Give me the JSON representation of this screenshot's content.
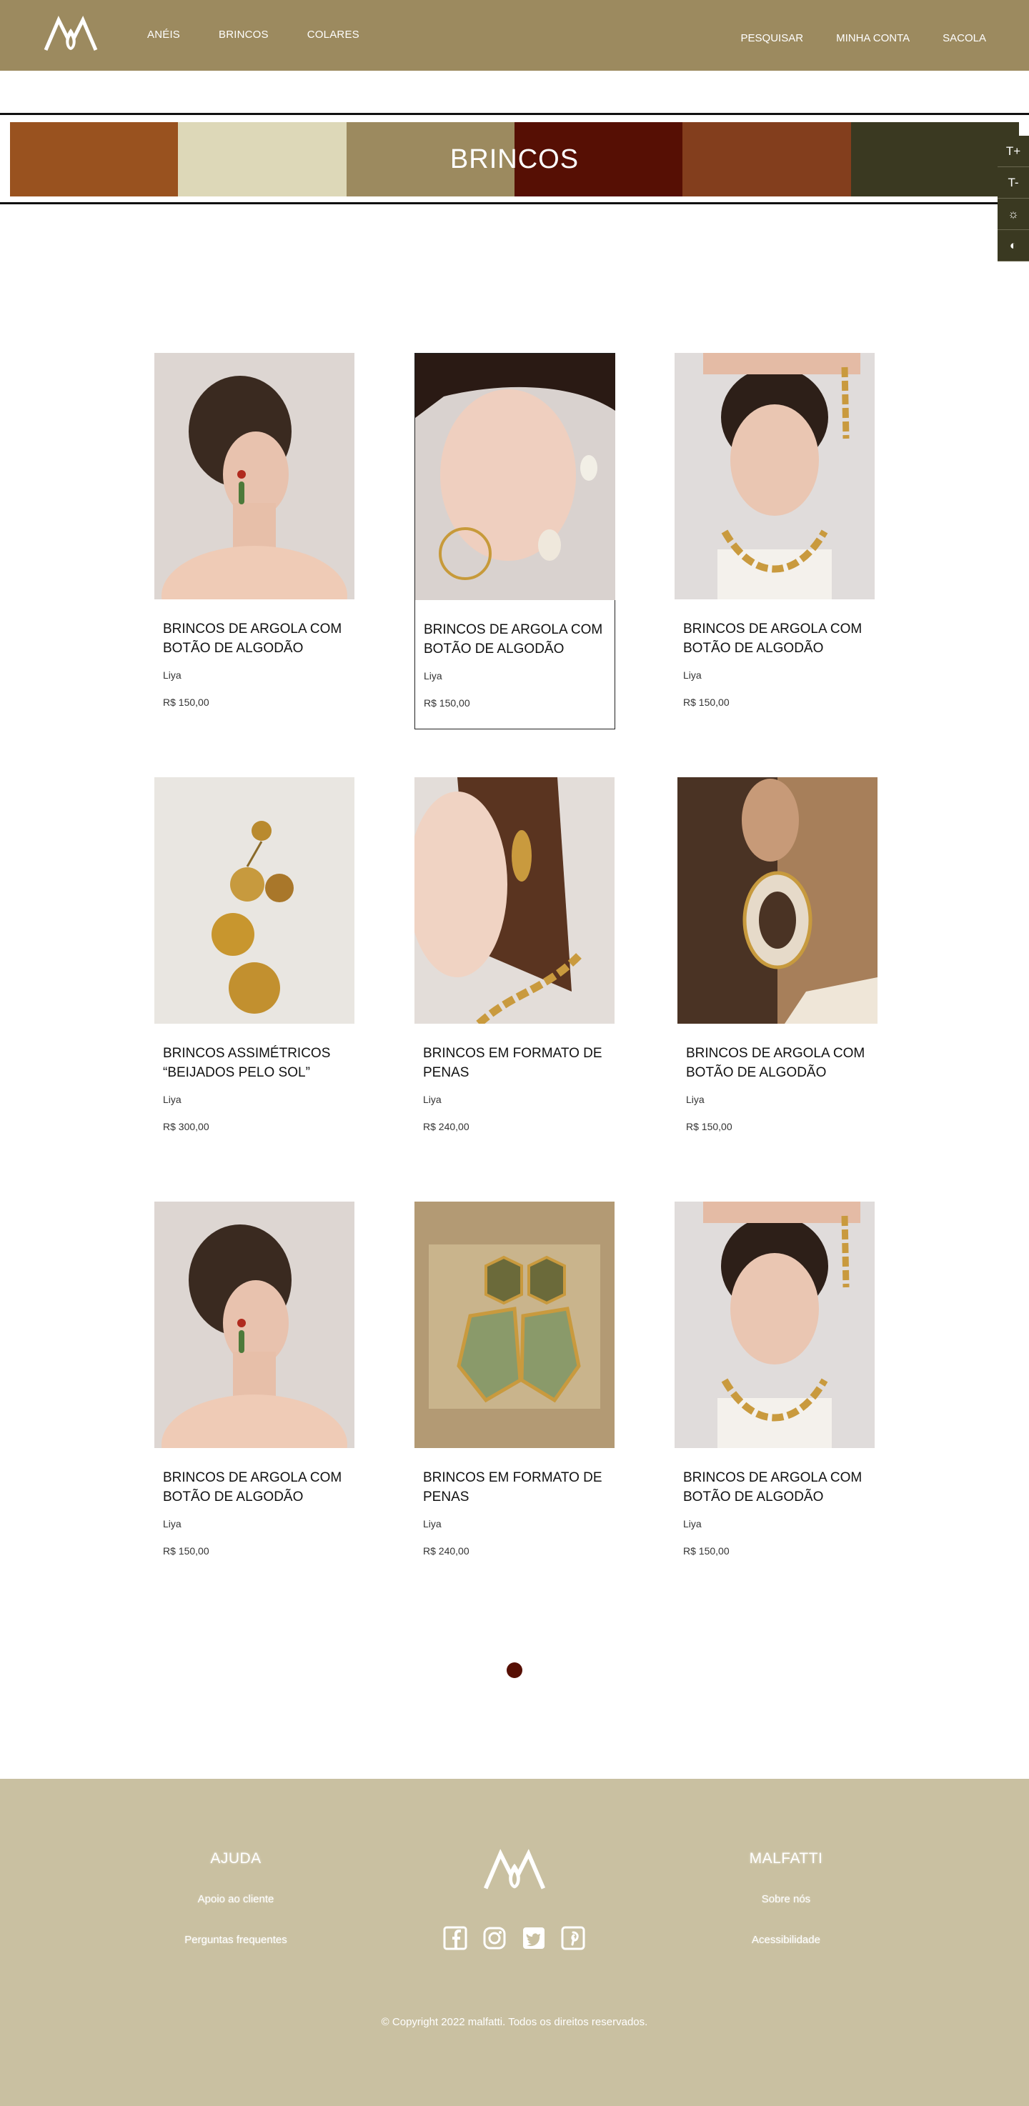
{
  "header": {
    "logo_alt": "malfatti",
    "nav_left": [
      "ANÉIS",
      "BRINCOS",
      "COLARES"
    ],
    "nav_right": [
      "PESQUISAR",
      "MINHA CONTA",
      "SACOLA"
    ]
  },
  "banner": {
    "title": "BRINCOS",
    "swatches": [
      "#99521f",
      "#ddd8b8",
      "#9c8a5f",
      "#560f04",
      "#833e1d",
      "#3a3921"
    ]
  },
  "a11y": [
    "T+",
    "T-",
    "☼",
    "◐"
  ],
  "products": [
    {
      "title": "BRINCOS DE ARGOLA COM BOTÃO DE ALGODÃO",
      "brand": "Liya",
      "price": "R$ 150,00"
    },
    {
      "title": "BRINCOS DE ARGOLA COM BOTÃO DE ALGODÃO",
      "brand": "Liya",
      "price": "R$ 150,00"
    },
    {
      "title": "BRINCOS DE ARGOLA COM BOTÃO DE ALGODÃO",
      "brand": "Liya",
      "price": "R$ 150,00"
    },
    {
      "title": "BRINCOS ASSIMÉTRICOS “BEIJADOS PELO SOL”",
      "brand": "Liya",
      "price": "R$ 300,00"
    },
    {
      "title": "BRINCOS EM FORMATO DE PENAS",
      "brand": "Liya",
      "price": "R$ 240,00"
    },
    {
      "title": "BRINCOS DE ARGOLA COM BOTÃO DE ALGODÃO",
      "brand": "Liya",
      "price": "R$ 150,00"
    },
    {
      "title": "BRINCOS DE ARGOLA COM BOTÃO DE ALGODÃO",
      "brand": "Liya",
      "price": "R$ 150,00"
    },
    {
      "title": "BRINCOS EM FORMATO DE PENAS",
      "brand": "Liya",
      "price": "R$ 240,00"
    },
    {
      "title": "BRINCOS DE ARGOLA COM BOTÃO DE ALGODÃO",
      "brand": "Liya",
      "price": "R$ 150,00"
    }
  ],
  "footer": {
    "help_heading": "AJUDA",
    "help_links": [
      "Apoio ao cliente",
      "Perguntas frequentes"
    ],
    "brand_heading": "MALFATTI",
    "brand_links": [
      "Sobre nós",
      "Acessibilidade"
    ],
    "copyright": "© Copyright 2022 malfatti. Todos os direitos reservados."
  }
}
